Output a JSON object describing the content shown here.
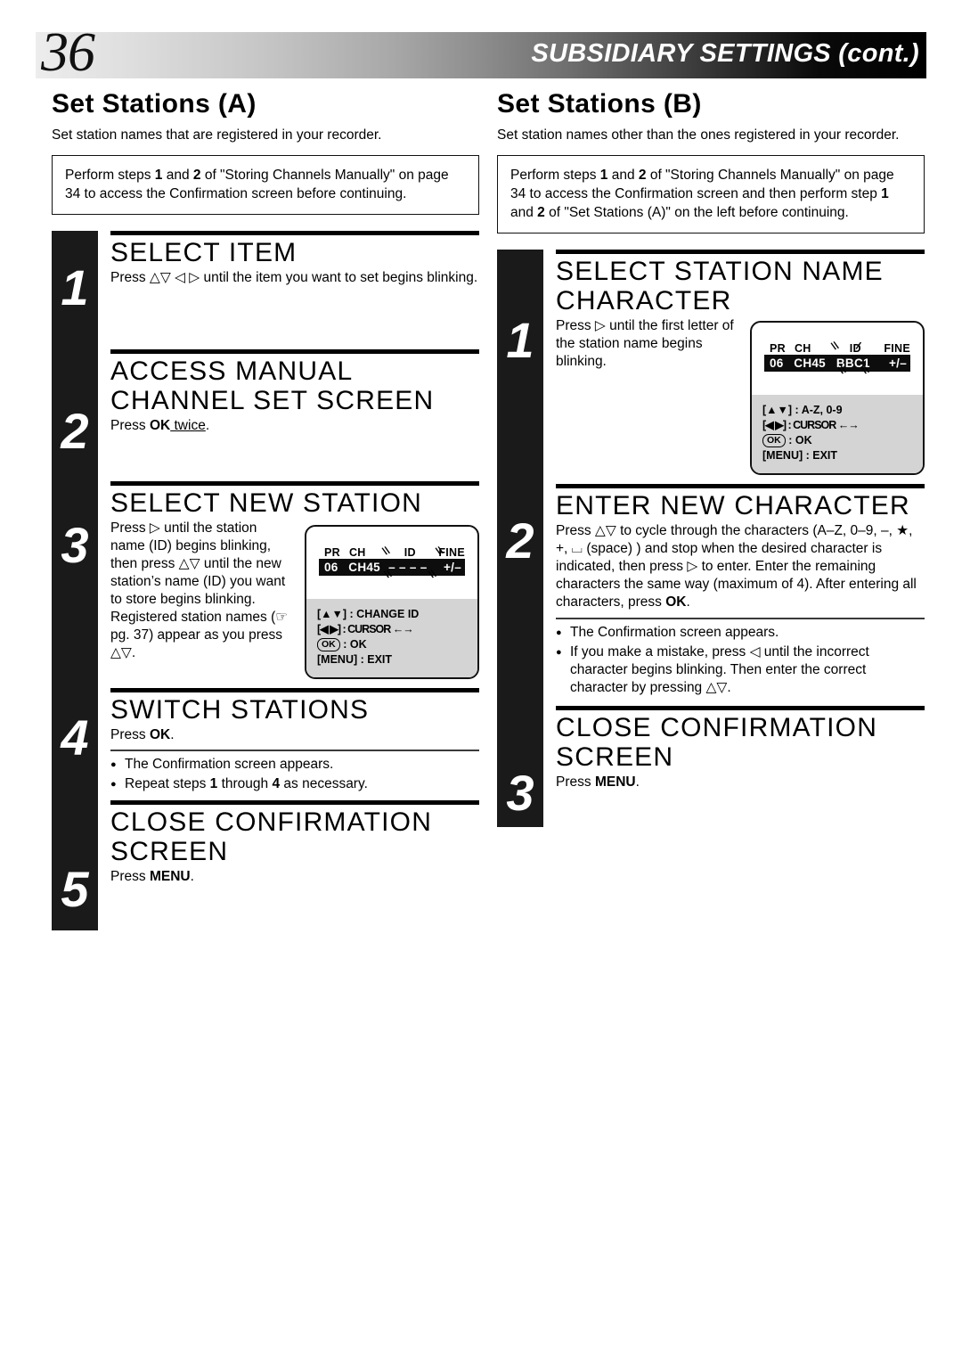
{
  "header": {
    "page_number": "36",
    "title": "SUBSIDIARY SETTINGS (cont.)"
  },
  "left": {
    "section_title": "Set Stations (A)",
    "lede": "Set station names that are registered in your recorder.",
    "notebox": {
      "part1": "Perform steps ",
      "b1": "1",
      "part2": " and ",
      "b2": "2",
      "part3": " of \"Storing Channels Manually\" on page 34 to access the Confirmation screen before continuing."
    },
    "steps": [
      {
        "num": "1",
        "heading": "SELECT ITEM",
        "body": "Press △▽ ◁ ▷ until the item you want to set begins blinking."
      },
      {
        "num": "2",
        "heading": "ACCESS MANUAL CHANNEL SET SCREEN",
        "body_pre": "Press ",
        "body_bold": "OK",
        "body_underline": " twice",
        "body_post": "."
      },
      {
        "num": "3",
        "heading": "SELECT NEW STATION",
        "body": "Press ▷ until the station name (ID) begins blinking, then press △▽ until the new station’s name (ID) you want to store begins blinking.",
        "body2_pre": "Registered station names (",
        "body2_icon": "☞",
        "body2_mid": " pg. 37) appear as you press △▽."
      },
      {
        "num": "4",
        "heading": "SWITCH STATIONS",
        "body_pre": "Press ",
        "body_bold": "OK",
        "body_post": ".",
        "bullets": [
          "The Confirmation screen appears.",
          "Repeat steps 1 through 4 as necessary."
        ],
        "bullet2_pre": "Repeat steps ",
        "bullet2_b1": "1",
        "bullet2_mid": " through ",
        "bullet2_b2": "4",
        "bullet2_post": " as necessary."
      },
      {
        "num": "5",
        "heading": "CLOSE CONFIRMATION SCREEN",
        "body_pre": "Press ",
        "body_bold": "MENU",
        "body_post": "."
      }
    ],
    "tv_figure": {
      "columns": [
        "PR",
        "CH",
        "ID",
        "FINE"
      ],
      "values": [
        "06",
        "CH45",
        "– – – –",
        "+/–"
      ],
      "keys": [
        "[▲▼] : CHANGE ID",
        "[◀ ▶] : CURSOR ←→",
        ": OK",
        "[MENU] : EXIT"
      ],
      "ok_glyph": "OK"
    }
  },
  "right": {
    "section_title": "Set Stations (B)",
    "lede": "Set station names other than the ones registered in your recorder.",
    "notebox": {
      "part1": "Perform steps ",
      "b1": "1",
      "part2": " and ",
      "b2": "2",
      "part3": " of \"Storing Channels Manually\" on page 34 to access the Confirmation screen and then perform step ",
      "b3": "1",
      "part4": " and ",
      "b4": "2",
      "part5": " of \"Set Stations (A)\" on the left before continuing."
    },
    "steps": [
      {
        "num": "1",
        "heading": "SELECT STATION NAME CHARACTER",
        "body": "Press ▷ until the first letter of the station name begins blinking."
      },
      {
        "num": "2",
        "heading": "ENTER NEW CHARACTER",
        "body_pre": "Press △▽ to cycle through the characters (A–Z, 0–9, –, ★, +, ⌴ (space) ) and stop when the desired character is indicated, then press ▷ to enter. Enter the remaining characters the same way (maximum of 4). After entering all characters, press ",
        "body_bold": "OK",
        "body_post": ".",
        "bullets": [
          "The Confirmation screen appears.",
          "If you make a mistake, press ◁ until the incorrect character begins blinking. Then enter the correct character by pressing △▽."
        ]
      },
      {
        "num": "3",
        "heading": "CLOSE CONFIRMATION SCREEN",
        "body_pre": "Press ",
        "body_bold": "MENU",
        "body_post": "."
      }
    ],
    "tv_figure": {
      "columns": [
        "PR",
        "CH",
        "ID",
        "FINE"
      ],
      "values": [
        "06",
        "CH45",
        "BBC1",
        "+/–"
      ],
      "keys": [
        "[▲▼] : A-Z, 0-9",
        "[◀ ▶] : CURSOR ←→",
        ": OK",
        "[MENU] : EXIT"
      ],
      "ok_glyph": "OK"
    }
  }
}
